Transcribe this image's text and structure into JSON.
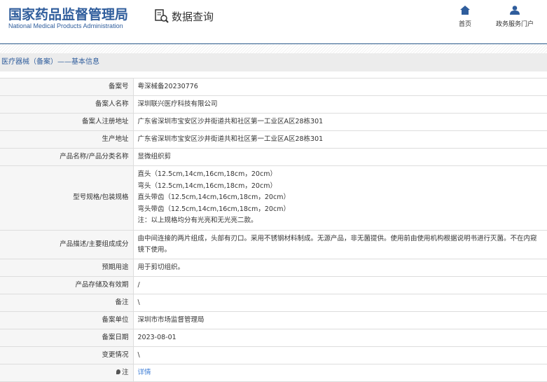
{
  "header": {
    "logo_cn": "国家药品监督管理局",
    "logo_en": "National Medical Products Administration",
    "title": "数据查询",
    "nav": [
      {
        "label": "首页",
        "icon": "home-icon"
      },
      {
        "label": "政务服务门户",
        "icon": "user-icon"
      }
    ]
  },
  "breadcrumb": "医疗器械（备案）——基本信息",
  "rows": [
    {
      "label": "备案号",
      "value": "粤深械备20230776"
    },
    {
      "label": "备案人名称",
      "value": "深圳联兴医疗科技有限公司"
    },
    {
      "label": "备案人注册地址",
      "value": "广东省深圳市宝安区沙井街道共和社区第一工业区A区28栋301"
    },
    {
      "label": "生产地址",
      "value": "广东省深圳市宝安区沙井街道共和社区第一工业区A区28栋301"
    },
    {
      "label": "产品名称/产品分类名称",
      "value": "显微组织剪"
    },
    {
      "label": "型号规格/包装规格",
      "lines": [
        "直头（12.5cm,14cm,16cm,18cm，20cm）",
        "弯头（12.5cm,14cm,16cm,18cm，20cm）",
        "直头带齿（12.5cm,14cm,16cm,18cm，20cm）",
        "弯头带齿（12.5cm,14cm,16cm,18cm，20cm）",
        "注：以上规格均分有光亮和无光亮二款。"
      ]
    },
    {
      "label": "产品描述/主要组成成分",
      "value": "由中间连接的两片组成，头部有刃口。采用不锈钢材料制成。无源产品，非无菌提供。使用前由使用机构根据说明书进行灭菌。不在内窥镜下使用。"
    },
    {
      "label": "预期用途",
      "value": "用于剪切组织。"
    },
    {
      "label": "产品存储及有效期",
      "value": "/"
    },
    {
      "label": "备注",
      "value": "\\"
    },
    {
      "label": "备案单位",
      "value": "深圳市市场监督管理局"
    },
    {
      "label": "备案日期",
      "value": "2023-08-01"
    },
    {
      "label": "变更情况",
      "value": "\\"
    },
    {
      "label": "注",
      "value": "详情"
    }
  ]
}
